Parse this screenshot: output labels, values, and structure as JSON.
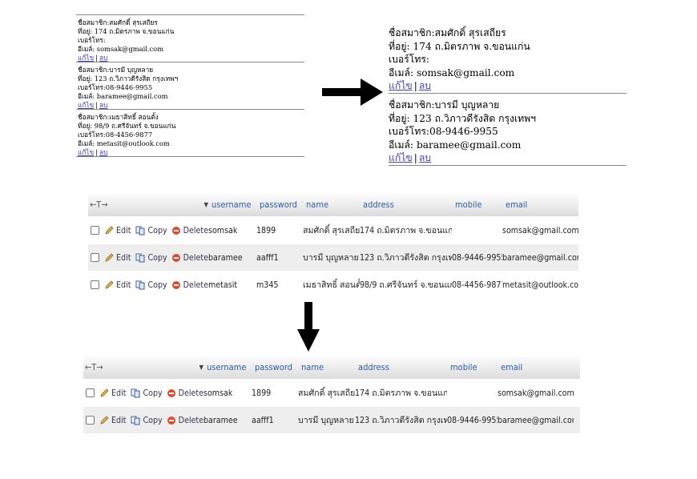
{
  "member_list": {
    "label_name": "ชื่อสมาชิก:",
    "label_address": "ที่อยู่:",
    "label_mobile": "เบอร์โทร:",
    "label_email": "อีเมล์:",
    "edit_label": "แก้ไข",
    "delete_label": "ลบ",
    "separator": "|",
    "before": [
      {
        "name": "สมศักดิ์ สุรเสถียร",
        "address": "174 ถ.มิตรภาพ จ.ขอนแก่น",
        "mobile": "",
        "email": "somsak@gmail.com"
      },
      {
        "name": "บารมี บุญหลาย",
        "address": "123 ถ.วิภาวดีรังสิต กรุงเทพฯ",
        "mobile": "08-9446-9955",
        "email": "baramee@gmail.com"
      },
      {
        "name": "เมธาสิทธิ์ สอนตั้ง",
        "address": "98/9 ถ.ศรีจันทร์ จ.ขอนแก่น",
        "mobile": "08-4456-9877",
        "email": "metasit@outlook.com"
      }
    ],
    "after": [
      {
        "name": "สมศักดิ์ สุรเสถียร",
        "address": "174 ถ.มิตรภาพ จ.ขอนแก่น",
        "mobile": "",
        "email": "somsak@gmail.com"
      },
      {
        "name": "บารมี บุญหลาย",
        "address": "123 ถ.วิภาวดีรังสิต กรุงเทพฯ",
        "mobile": "08-9446-9955",
        "email": "baramee@gmail.com"
      }
    ]
  },
  "db_table": {
    "nav_control": "←T→",
    "sort_indicator": "▼",
    "columns": [
      "username",
      "password",
      "name",
      "address",
      "mobile",
      "email"
    ],
    "action_edit": "Edit",
    "action_copy": "Copy",
    "action_delete": "Delete",
    "before_rows": [
      [
        "somsak",
        "1899",
        "สมศักดิ์ สุรเสถียร",
        "174 ถ.มิตรภาพ จ.ขอนแก่น",
        "",
        "somsak@gmail.com"
      ],
      [
        "baramee",
        "aafff1",
        "บารมี บุญหลาย",
        "123 ถ.วิภาวดีรังสิต กรุงเทพฯ",
        "08-9446-9955",
        "baramee@gmail.com"
      ],
      [
        "metasit",
        "m345",
        "เมธาสิทธิ์ สอนตั้ง",
        "98/9 ถ.ศรีจันทร์ จ.ขอนแก่น",
        "08-4456-9877",
        "metasit@outlook.com"
      ]
    ],
    "after_rows": [
      [
        "somsak",
        "1899",
        "สมศักดิ์ สุรเสถียร",
        "174 ถ.มิตรภาพ จ.ขอนแก่น",
        "",
        "somsak@gmail.com"
      ],
      [
        "baramee",
        "aafff1",
        "บารมี บุญหลาย",
        "123 ถ.วิภาวดีรังสิต กรุงเทพฯ",
        "08-9446-9955",
        "baramee@gmail.com"
      ]
    ]
  },
  "colors": {
    "link": "#4040c0",
    "header_text": "#2a5ea8",
    "arrow": "#000000",
    "delete_icon": "#e04a2a"
  }
}
